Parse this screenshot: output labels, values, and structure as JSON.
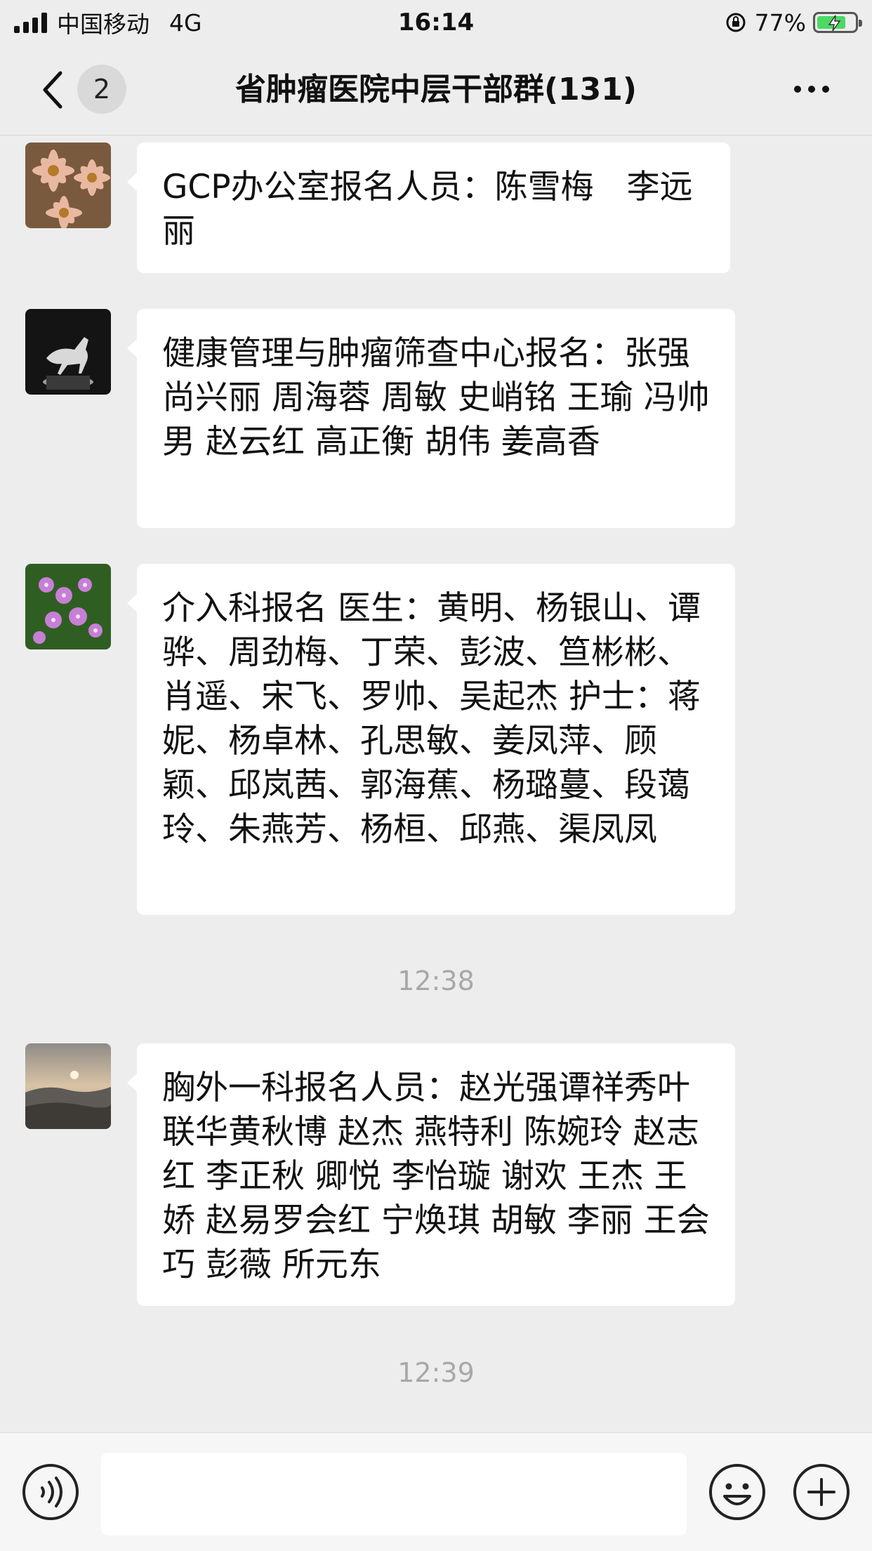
{
  "status_bar": {
    "carrier": "中国移动",
    "network": "4G",
    "time": "16:14",
    "battery_percent": "77%",
    "battery_level": 0.77
  },
  "nav": {
    "unread_count": "2",
    "title": "省肿瘤医院中层干部群(131)"
  },
  "messages": [
    {
      "avatar_icon": "flower-avatar",
      "text": "GCP办公室报名人员：陈雪梅　李远丽"
    },
    {
      "avatar_icon": "horse-statue-avatar",
      "text": "健康管理与肿瘤筛查中心报名：张强 尚兴丽 周海蓉 周敏 史峭铭 王瑜 冯帅男 赵云红 高正衡 胡伟 姜高香"
    },
    {
      "avatar_icon": "purple-flowers-avatar",
      "text": "介入科报名  医生：黄明、杨银山、谭骅、周劲梅、丁荣、彭波、笪彬彬、肖遥、宋飞、罗帅、吴起杰  护士：蒋妮、杨卓林、孔思敏、姜凤萍、顾颖、邱岚茜、郭海蕉、杨璐蔓、段蔼玲、朱燕芳、杨桓、邱燕、渠凤凤"
    },
    {
      "avatar_icon": "sunset-landscape-avatar",
      "text": "胸外一科报名人员：赵光强谭祥秀叶联华黄秋博 赵杰 燕特利 陈婉玲 赵志红 李正秋 卿悦 李怡璇 谢欢 王杰 王娇 赵易罗会红 宁焕琪 胡敏  李丽 王会巧 彭薇 所元东"
    }
  ],
  "timestamps": [
    "12:38",
    "12:39"
  ],
  "input": {
    "placeholder": ""
  },
  "colors": {
    "background": "#ededed",
    "bubble": "#ffffff",
    "battery": "#4cd964",
    "timestamp": "#a8a8a8"
  }
}
